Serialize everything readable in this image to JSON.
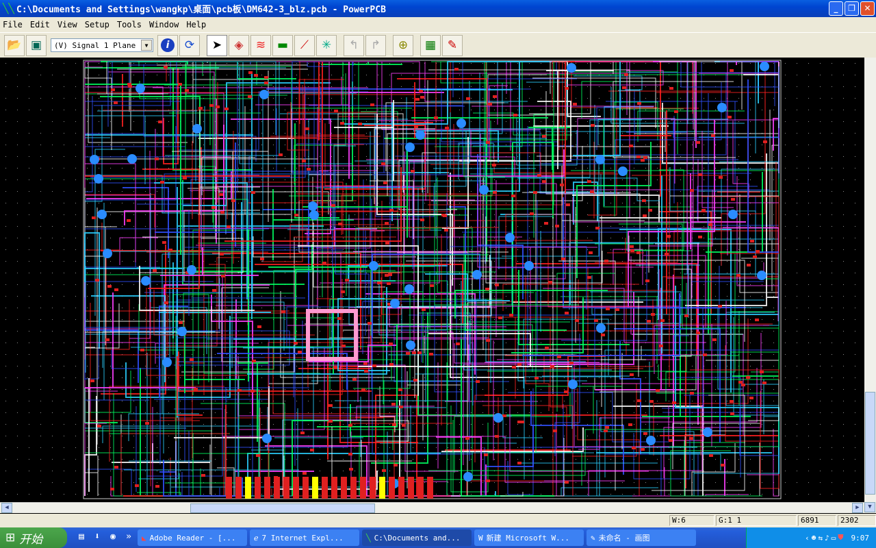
{
  "window": {
    "title": "C:\\Documents and Settings\\wangkp\\桌面\\pcb板\\DM642-3_blz.pcb - PowerPCB",
    "minimize": "_",
    "restore": "❐",
    "close": "✕"
  },
  "menu": [
    "File",
    "Edit",
    "View",
    "Setup",
    "Tools",
    "Window",
    "Help"
  ],
  "toolbar": {
    "layer_select": "(V) Signal 1 Plane",
    "buttons": [
      "open-icon",
      "save-icon",
      "info-icon",
      "refresh-icon",
      "select-arrow-icon",
      "design-toolbar-icon",
      "route-toolbar-icon",
      "dimension-toolbar-icon",
      "ecO-toolbar-icon",
      "bga-toolbar-icon",
      "undo-icon",
      "redo-icon",
      "zoom-icon",
      "pour-manager-icon",
      "drafting-icon"
    ]
  },
  "pcb_colors": [
    "#ff2020",
    "#2ad0ff",
    "#00ff60",
    "#3050ff",
    "#ffffff",
    "#ff40ff",
    "#ffff00",
    "#20c0c0"
  ],
  "status": {
    "width": "W:6",
    "grid": "G:1 1",
    "x": "6891",
    "y": "2302"
  },
  "taskbar": {
    "start": "开始",
    "tasks": [
      "Adobe Reader - [...",
      "7 Internet Expl...",
      "C:\\Documents and...",
      "新建 Microsoft W...",
      "未命名 - 画图"
    ],
    "clock": "9:07"
  }
}
